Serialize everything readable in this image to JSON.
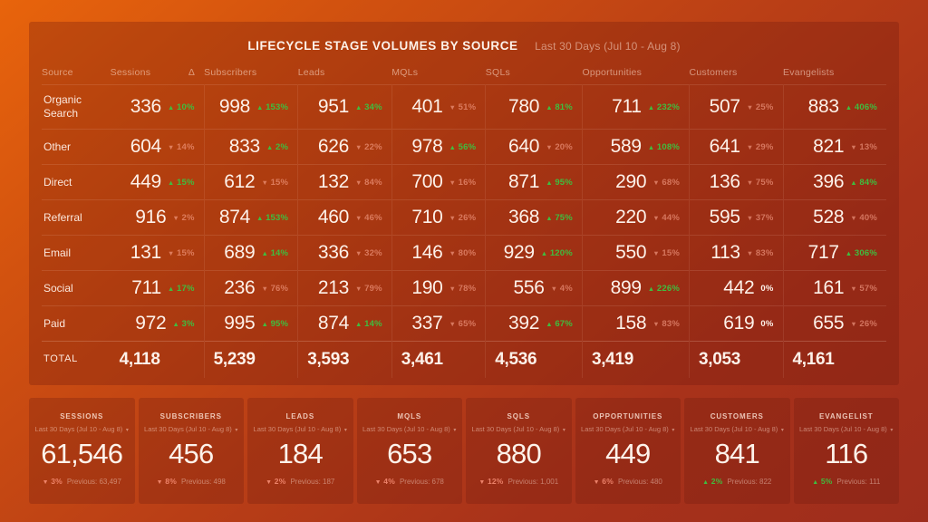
{
  "panel": {
    "title": "LIFECYCLE STAGE VOLUMES BY SOURCE",
    "subtitle": "Last 30 Days (Jul 10 - Aug 8)",
    "columns": [
      "Source",
      "Sessions",
      "Δ",
      "Subscribers",
      "Leads",
      "MQLs",
      "SQLs",
      "Opportunities",
      "Customers",
      "Evangelists"
    ],
    "total_label": "TOTAL",
    "rows": [
      {
        "source": "Organic Search",
        "cells": [
          {
            "value": "336",
            "delta": "10%",
            "dir": "up"
          },
          {
            "value": "998",
            "delta": "153%",
            "dir": "up"
          },
          {
            "value": "951",
            "delta": "34%",
            "dir": "up"
          },
          {
            "value": "401",
            "delta": "51%",
            "dir": "down"
          },
          {
            "value": "780",
            "delta": "81%",
            "dir": "up"
          },
          {
            "value": "711",
            "delta": "232%",
            "dir": "up"
          },
          {
            "value": "507",
            "delta": "25%",
            "dir": "down"
          },
          {
            "value": "883",
            "delta": "406%",
            "dir": "up"
          }
        ]
      },
      {
        "source": "Other",
        "cells": [
          {
            "value": "604",
            "delta": "14%",
            "dir": "down"
          },
          {
            "value": "833",
            "delta": "2%",
            "dir": "up"
          },
          {
            "value": "626",
            "delta": "22%",
            "dir": "down"
          },
          {
            "value": "978",
            "delta": "56%",
            "dir": "up"
          },
          {
            "value": "640",
            "delta": "20%",
            "dir": "down"
          },
          {
            "value": "589",
            "delta": "108%",
            "dir": "up"
          },
          {
            "value": "641",
            "delta": "29%",
            "dir": "down"
          },
          {
            "value": "821",
            "delta": "13%",
            "dir": "down"
          }
        ]
      },
      {
        "source": "Direct",
        "cells": [
          {
            "value": "449",
            "delta": "15%",
            "dir": "up"
          },
          {
            "value": "612",
            "delta": "15%",
            "dir": "down"
          },
          {
            "value": "132",
            "delta": "84%",
            "dir": "down"
          },
          {
            "value": "700",
            "delta": "16%",
            "dir": "down"
          },
          {
            "value": "871",
            "delta": "95%",
            "dir": "up"
          },
          {
            "value": "290",
            "delta": "68%",
            "dir": "down"
          },
          {
            "value": "136",
            "delta": "75%",
            "dir": "down"
          },
          {
            "value": "396",
            "delta": "84%",
            "dir": "up"
          }
        ]
      },
      {
        "source": "Referral",
        "cells": [
          {
            "value": "916",
            "delta": "2%",
            "dir": "down"
          },
          {
            "value": "874",
            "delta": "153%",
            "dir": "up"
          },
          {
            "value": "460",
            "delta": "46%",
            "dir": "down"
          },
          {
            "value": "710",
            "delta": "26%",
            "dir": "down"
          },
          {
            "value": "368",
            "delta": "75%",
            "dir": "up"
          },
          {
            "value": "220",
            "delta": "44%",
            "dir": "down"
          },
          {
            "value": "595",
            "delta": "37%",
            "dir": "down"
          },
          {
            "value": "528",
            "delta": "40%",
            "dir": "down"
          }
        ]
      },
      {
        "source": "Email",
        "cells": [
          {
            "value": "131",
            "delta": "15%",
            "dir": "down"
          },
          {
            "value": "689",
            "delta": "14%",
            "dir": "up"
          },
          {
            "value": "336",
            "delta": "32%",
            "dir": "down"
          },
          {
            "value": "146",
            "delta": "80%",
            "dir": "down"
          },
          {
            "value": "929",
            "delta": "120%",
            "dir": "up"
          },
          {
            "value": "550",
            "delta": "15%",
            "dir": "down"
          },
          {
            "value": "113",
            "delta": "83%",
            "dir": "down"
          },
          {
            "value": "717",
            "delta": "306%",
            "dir": "up"
          }
        ]
      },
      {
        "source": "Social",
        "cells": [
          {
            "value": "711",
            "delta": "17%",
            "dir": "up"
          },
          {
            "value": "236",
            "delta": "76%",
            "dir": "down"
          },
          {
            "value": "213",
            "delta": "79%",
            "dir": "down"
          },
          {
            "value": "190",
            "delta": "78%",
            "dir": "down"
          },
          {
            "value": "556",
            "delta": "4%",
            "dir": "down"
          },
          {
            "value": "899",
            "delta": "226%",
            "dir": "up"
          },
          {
            "value": "442",
            "delta": "0%",
            "dir": "flat"
          },
          {
            "value": "161",
            "delta": "57%",
            "dir": "down"
          }
        ]
      },
      {
        "source": "Paid",
        "cells": [
          {
            "value": "972",
            "delta": "3%",
            "dir": "up"
          },
          {
            "value": "995",
            "delta": "95%",
            "dir": "up"
          },
          {
            "value": "874",
            "delta": "14%",
            "dir": "up"
          },
          {
            "value": "337",
            "delta": "65%",
            "dir": "down"
          },
          {
            "value": "392",
            "delta": "67%",
            "dir": "up"
          },
          {
            "value": "158",
            "delta": "83%",
            "dir": "down"
          },
          {
            "value": "619",
            "delta": "0%",
            "dir": "flat"
          },
          {
            "value": "655",
            "delta": "26%",
            "dir": "down"
          }
        ]
      }
    ],
    "totals": [
      "4,118",
      "5,239",
      "3,593",
      "3,461",
      "4,536",
      "3,419",
      "3,053",
      "4,161"
    ]
  },
  "kpis": [
    {
      "label": "SESSIONS",
      "range": "Last 30 Days (Jul 10 - Aug 8)",
      "value": "61,546",
      "change": "3%",
      "dir": "down",
      "previous": "Previous: 63,497"
    },
    {
      "label": "SUBSCRIBERS",
      "range": "Last 30 Days (Jul 10 - Aug 8)",
      "value": "456",
      "change": "8%",
      "dir": "down",
      "previous": "Previous: 498"
    },
    {
      "label": "LEADS",
      "range": "Last 30 Days (Jul 10 - Aug 8)",
      "value": "184",
      "change": "2%",
      "dir": "down",
      "previous": "Previous: 187"
    },
    {
      "label": "MQLS",
      "range": "Last 30 Days (Jul 10 - Aug 8)",
      "value": "653",
      "change": "4%",
      "dir": "down",
      "previous": "Previous: 678"
    },
    {
      "label": "SQLS",
      "range": "Last 30 Days (Jul 10 - Aug 8)",
      "value": "880",
      "change": "12%",
      "dir": "down",
      "previous": "Previous: 1,001"
    },
    {
      "label": "OPPORTUNITIES",
      "range": "Last 30 Days (Jul 10 - Aug 8)",
      "value": "449",
      "change": "6%",
      "dir": "down",
      "previous": "Previous: 480"
    },
    {
      "label": "CUSTOMERS",
      "range": "Last 30 Days (Jul 10 - Aug 8)",
      "value": "841",
      "change": "2%",
      "dir": "up",
      "previous": "Previous: 822"
    },
    {
      "label": "EVANGELIST",
      "range": "Last 30 Days (Jul 10 - Aug 8)",
      "value": "116",
      "change": "5%",
      "dir": "up",
      "previous": "Previous: 111"
    }
  ],
  "icons": {
    "arrow_up": "▲",
    "arrow_down": "▼",
    "caret_down": "▾"
  },
  "colors": {
    "positive": "#3fbd3f",
    "negative": "#ff9a7e",
    "text": "#fdf2ea"
  }
}
